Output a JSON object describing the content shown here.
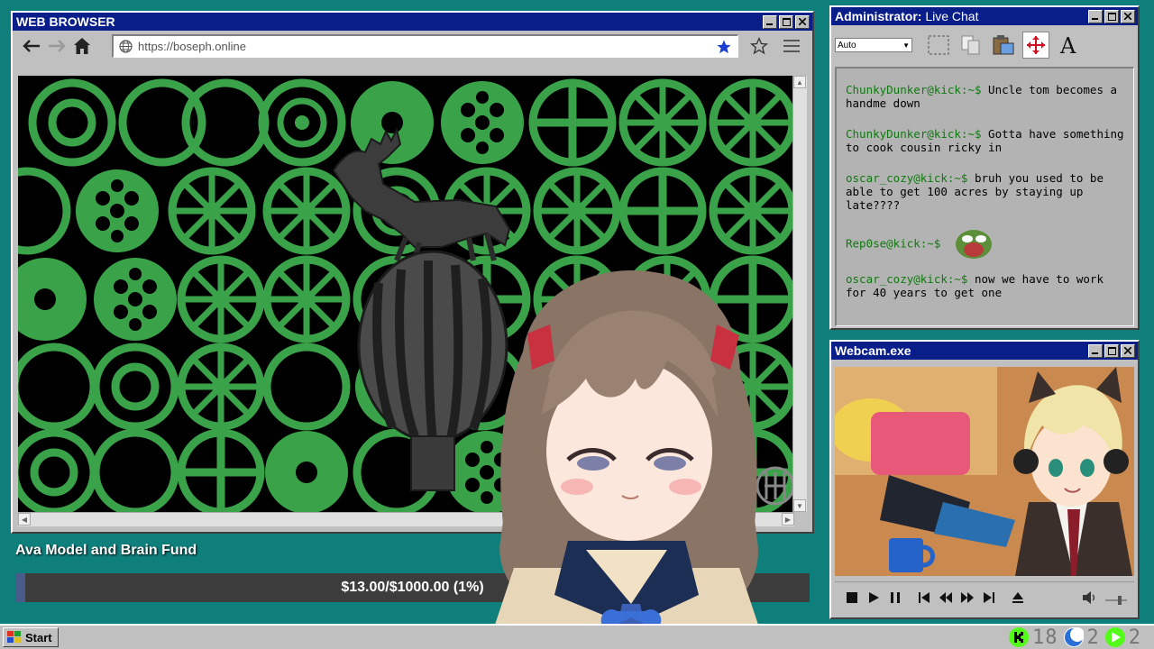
{
  "browser": {
    "title": "WEB BROWSER",
    "url": "https://boseph.online"
  },
  "fund": {
    "title": "Ava Model and Brain Fund",
    "progress_text": "$13.00/$1000.00 (1%)",
    "progress_fraction": 0.013
  },
  "chat": {
    "title_prefix": "Administrator:",
    "title_rest": " Live Chat",
    "select_value": "Auto",
    "messages": [
      {
        "user": "ChunkyDunker@kick:~$",
        "text": " Uncle tom becomes a handme down"
      },
      {
        "user": "ChunkyDunker@kick:~$",
        "text": " Gotta have something to cook cousin ricky in"
      },
      {
        "user": "oscar_cozy@kick:~$",
        "text": " bruh you used to be able to get 100 acres by staying up late????"
      },
      {
        "user": "Rep0se@kick:~$",
        "text": ""
      },
      {
        "user": "oscar_cozy@kick:~$",
        "text": " now we have to work for 40 years to get one"
      }
    ]
  },
  "webcam": {
    "title": "Webcam.exe"
  },
  "taskbar": {
    "start_label": "Start",
    "tray": [
      {
        "icon": "kick-icon",
        "value": "18",
        "color": "#53fc18"
      },
      {
        "icon": "moon-icon",
        "value": "2",
        "color": "#2a6fd6"
      },
      {
        "icon": "play-icon",
        "value": "2",
        "color": "#53fc18"
      }
    ]
  },
  "colors": {
    "desktop": "#0f7f7c",
    "titlebar": "#0a1e8a",
    "pattern_green": "#3aa34a",
    "chat_user": "#0f7a0f"
  }
}
